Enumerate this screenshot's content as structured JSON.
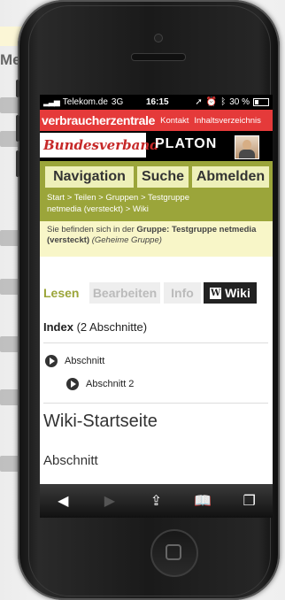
{
  "background": {
    "partial_title": "Me"
  },
  "status_bar": {
    "carrier": "Telekom.de",
    "network": "3G",
    "time": "16:15",
    "battery": "30 %"
  },
  "topbar": {
    "logo": "verbraucherzentrale",
    "links": [
      "Kontakt",
      "Inhaltsverzeichnis"
    ]
  },
  "brand": {
    "bundesverband": "Bundesverband",
    "platon": "PLATON"
  },
  "nav": {
    "navigation": "Navigation",
    "suche": "Suche",
    "abmelden": "Abmelden"
  },
  "breadcrumb": {
    "line1": "Start  >  Teilen  >  Gruppen  >  Testgruppe",
    "line2": "netmedia (versteckt)  >  Wiki"
  },
  "notice": {
    "prefix": "Sie befinden sich in der ",
    "group_label": "Gruppe: Testgruppe netmedia (versteckt)",
    "suffix": "(Geheime Gruppe)"
  },
  "tabs": {
    "lesen": "Lesen",
    "bearbeiten": "Bearbeiten",
    "info": "Info",
    "wiki": "Wiki",
    "wiki_icon": "W"
  },
  "index": {
    "title": "Index",
    "count": "(2 Abschnitte)"
  },
  "sections": [
    {
      "label": "Abschnitt"
    },
    {
      "label": "Abschnitt 2"
    }
  ],
  "content": {
    "page_title": "Wiki-Startseite",
    "heading": "Abschnitt"
  },
  "toolbar": {
    "icons": [
      "back-icon",
      "forward-icon",
      "share-icon",
      "bookmarks-icon",
      "tabs-icon"
    ]
  },
  "colors": {
    "brand_red": "#e53a3a",
    "nav_green": "#9ba53a",
    "nav_button": "#eef0b9",
    "notice_bg": "#f8f6c8"
  }
}
